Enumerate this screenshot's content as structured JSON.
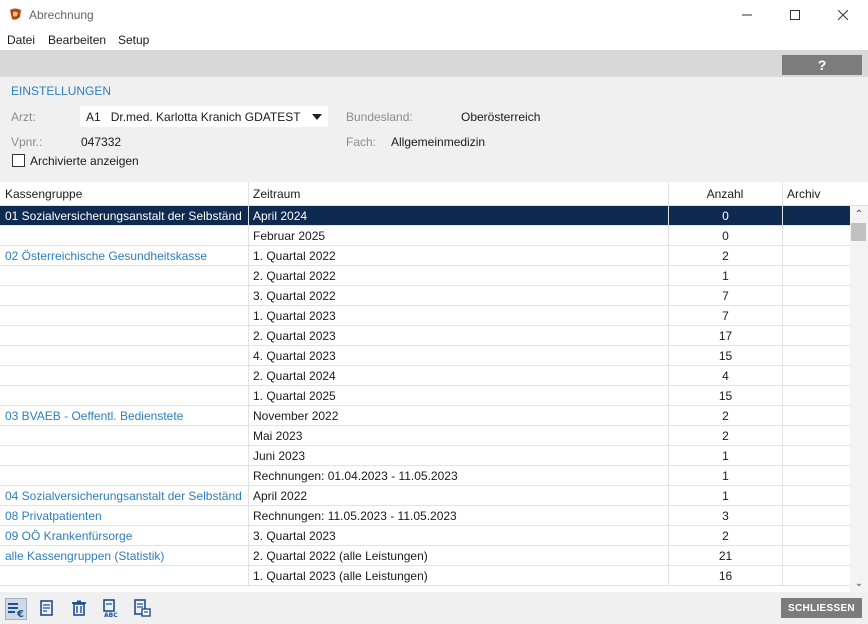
{
  "window": {
    "title": "Abrechnung",
    "controls": {
      "minimize_icon": "minimize-icon",
      "maximize_icon": "maximize-icon",
      "close_icon": "close-icon"
    }
  },
  "menu": [
    "Datei",
    "Bearbeiten",
    "Setup"
  ],
  "toolbar": {
    "help_label": "?"
  },
  "settings": {
    "section_title": "EINSTELLUNGEN",
    "arzt_label": "Arzt:",
    "arzt_code": "A1",
    "arzt_value": "Dr.med. Karlotta Kranich GDATEST",
    "vpnr_label": "Vpnr.:",
    "vpnr_value": "047332",
    "bundesland_label": "Bundesland:",
    "bundesland_value": "Oberösterreich",
    "fach_label": "Fach:",
    "fach_value": "Allgemeinmedizin",
    "archived_label": "Archivierte anzeigen",
    "archived_checked": false
  },
  "table": {
    "columns": [
      "Kassengruppe",
      "Zeitraum",
      "Anzahl",
      "Archiv"
    ],
    "rows": [
      {
        "group": "01  Sozialversicherungsanstalt der Selbständ",
        "period": "April 2024",
        "count": "0",
        "archive": "",
        "selected": true
      },
      {
        "group": "",
        "period": "Februar 2025",
        "count": "0",
        "archive": ""
      },
      {
        "group": "02  Österreichische Gesundheitskasse",
        "period": "1. Quartal 2022",
        "count": "2",
        "archive": ""
      },
      {
        "group": "",
        "period": "2. Quartal 2022",
        "count": "1",
        "archive": ""
      },
      {
        "group": "",
        "period": "3. Quartal 2022",
        "count": "7",
        "archive": ""
      },
      {
        "group": "",
        "period": "1. Quartal 2023",
        "count": "7",
        "archive": ""
      },
      {
        "group": "",
        "period": "2. Quartal 2023",
        "count": "17",
        "archive": ""
      },
      {
        "group": "",
        "period": "4. Quartal 2023",
        "count": "15",
        "archive": ""
      },
      {
        "group": "",
        "period": "2. Quartal 2024",
        "count": "4",
        "archive": ""
      },
      {
        "group": "",
        "period": "1. Quartal 2025",
        "count": "15",
        "archive": ""
      },
      {
        "group": "03  BVAEB - Oeffentl. Bedienstete",
        "period": "November 2022",
        "count": "2",
        "archive": ""
      },
      {
        "group": "",
        "period": "Mai 2023",
        "count": "2",
        "archive": ""
      },
      {
        "group": "",
        "period": "Juni 2023",
        "count": "1",
        "archive": ""
      },
      {
        "group": "",
        "period": "Rechnungen: 01.04.2023 - 11.05.2023",
        "count": "1",
        "archive": ""
      },
      {
        "group": "04  Sozialversicherungsanstalt der Selbständ",
        "period": "April 2022",
        "count": "1",
        "archive": ""
      },
      {
        "group": "08  Privatpatienten",
        "period": "Rechnungen: 11.05.2023 - 11.05.2023",
        "count": "3",
        "archive": ""
      },
      {
        "group": "09  OÖ Krankenfürsorge",
        "period": "3. Quartal 2023",
        "count": "2",
        "archive": ""
      },
      {
        "group": "alle Kassengruppen (Statistik)",
        "period": "2. Quartal 2022 (alle Leistungen)",
        "count": "21",
        "archive": ""
      },
      {
        "group": "",
        "period": "1. Quartal 2023 (alle Leistungen)",
        "count": "16",
        "archive": ""
      }
    ]
  },
  "footer": {
    "icons": [
      "list-euro-icon",
      "document-edit-icon",
      "trash-icon",
      "abc-book-icon",
      "document-list-icon"
    ],
    "close_label": "SCHLIESSEN"
  },
  "colors": {
    "accent_blue": "#2d7ebd",
    "selected_row": "#0f2a50",
    "button_gray": "#7c7c7c",
    "icon_blue": "#1b4f93"
  }
}
